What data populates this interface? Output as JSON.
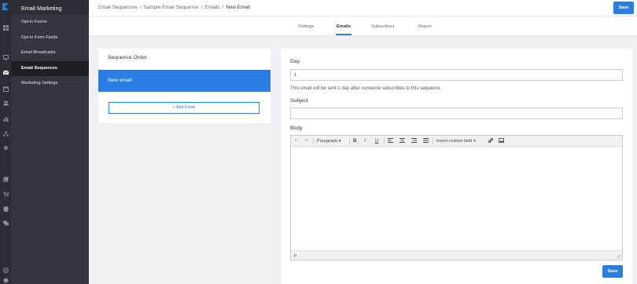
{
  "sidebar": {
    "title": "Email Marketing",
    "items": [
      {
        "label": "Opt-in Forms"
      },
      {
        "label": "Opt-in Form Fields"
      },
      {
        "label": "Email Broadcasts"
      },
      {
        "label": "Email Sequences"
      },
      {
        "label": "Marketing Settings"
      }
    ]
  },
  "breadcrumb": {
    "items": [
      "Email Sequences",
      "Sample Email Sequence",
      "Emails"
    ],
    "current": "New Email",
    "separator": "/"
  },
  "header": {
    "save_label": "Save"
  },
  "tabs": [
    {
      "label": "Settings"
    },
    {
      "label": "Emails"
    },
    {
      "label": "Subscribers"
    },
    {
      "label": "Report"
    }
  ],
  "sequence": {
    "title": "Sequence Order",
    "items": [
      {
        "label": "New email"
      }
    ],
    "add_label": "+ Add Email"
  },
  "form": {
    "day_label": "Day",
    "day_value": "1",
    "day_hint": "This email will be sent 1 day after someone subscribes to this sequence.",
    "subject_label": "Subject",
    "subject_value": "",
    "body_label": "Body",
    "save_label": "Save"
  },
  "editor": {
    "format_select": "Paragraph",
    "custom_field_select": "Insert custom field",
    "status_path": "p"
  },
  "colors": {
    "accent": "#2a7de1",
    "rail": "#2b2f35",
    "sidebar": "#33373d",
    "sidebar_active": "#1c1f23",
    "background": "#eef0f3"
  },
  "icons": {
    "rail": [
      "dashboard-icon",
      "monitor-icon",
      "mail-icon",
      "calendar-icon",
      "users-icon",
      "chart-icon",
      "network-icon",
      "gear-icon",
      "gallery-icon",
      "cart-icon",
      "database-icon",
      "chat-icon",
      "help-icon",
      "user-icon"
    ]
  }
}
